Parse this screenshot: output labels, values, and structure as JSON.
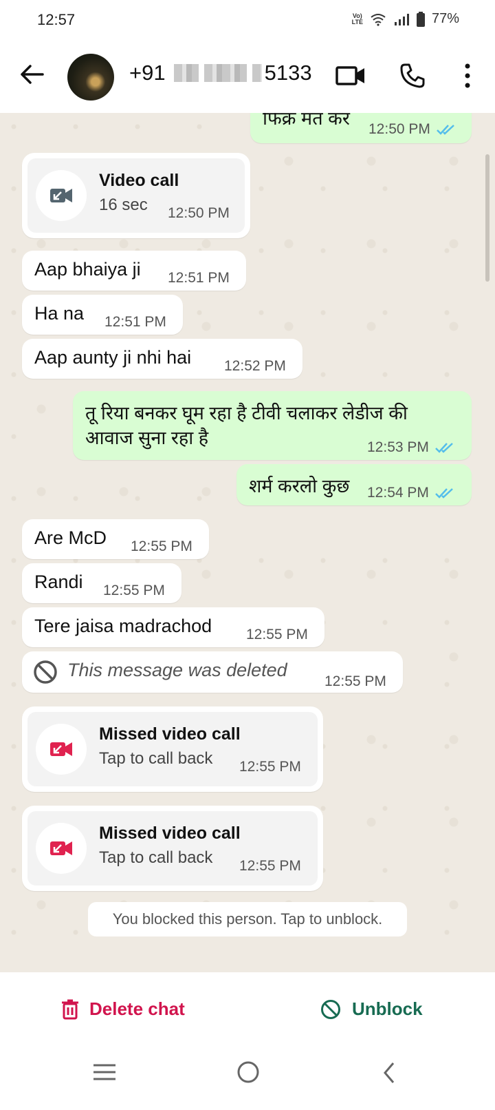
{
  "status_bar": {
    "time": "12:57",
    "lte_top": "Vo)",
    "lte_bottom": "LTE",
    "battery": "77%"
  },
  "header": {
    "prefix": "+91",
    "suffix": "5133"
  },
  "messages": [
    {
      "type": "text_out",
      "text": "फिक्र मत कर",
      "time": "12:50 PM"
    },
    {
      "type": "call",
      "title": "Video call",
      "subtitle": "16 sec",
      "time": "12:50 PM"
    },
    {
      "type": "text_in",
      "text": "Aap bhaiya ji",
      "time": "12:51 PM"
    },
    {
      "type": "text_in",
      "text": "Ha na",
      "time": "12:51 PM"
    },
    {
      "type": "text_in",
      "text": "Aap aunty ji nhi hai",
      "time": "12:52 PM"
    },
    {
      "type": "text_out",
      "line1": "तू रिया बनकर घूम रहा है टीवी चलाकर लेडीज की",
      "line2": "आवाज सुना रहा है",
      "time": "12:53 PM"
    },
    {
      "type": "text_out",
      "text": "शर्म करलो कुछ",
      "time": "12:54 PM"
    },
    {
      "type": "text_in",
      "text": "Are McD",
      "time": "12:55 PM"
    },
    {
      "type": "text_in",
      "text": "Randi",
      "time": "12:55 PM"
    },
    {
      "type": "text_in",
      "text": "Tere jaisa madrachod",
      "time": "12:55 PM"
    },
    {
      "type": "deleted",
      "text": "This message was deleted",
      "time": "12:55 PM"
    },
    {
      "type": "missed_call",
      "title": "Missed video call",
      "subtitle": "Tap to call back",
      "time": "12:55 PM"
    },
    {
      "type": "missed_call",
      "title": "Missed video call",
      "subtitle": "Tap to call back",
      "time": "12:55 PM"
    }
  ],
  "system_notice": "You blocked this person. Tap to unblock.",
  "actions": {
    "delete": "Delete chat",
    "unblock": "Unblock"
  },
  "colors": {
    "delete": "#d1144d",
    "unblock": "#176b52",
    "missed": "#e0224f",
    "tick": "#53bdeb",
    "outgoing": "#d9fdd3"
  }
}
